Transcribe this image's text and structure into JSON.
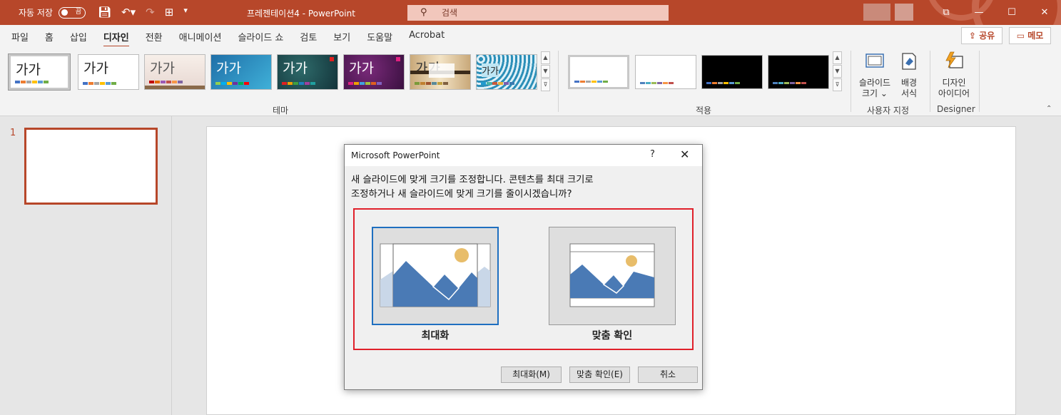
{
  "titlebar": {
    "autosave_label": "자동 저장",
    "autosave_state": "끔",
    "doc_title": "프레젠테이션4 - PowerPoint",
    "search_placeholder": "검색",
    "window_buttons": [
      "⧉",
      "—",
      "☐",
      "✕"
    ]
  },
  "menu": {
    "items": [
      "파일",
      "홈",
      "삽입",
      "디자인",
      "전환",
      "애니메이션",
      "슬라이드 쇼",
      "검토",
      "보기",
      "도움말",
      "Acrobat"
    ],
    "active": "디자인",
    "share": "공유",
    "memo": "메모"
  },
  "ribbon": {
    "theme_sample": "가가",
    "theme_group_label": "테마",
    "variant_group_label": "적용",
    "slide_size_line1": "슬라이드",
    "slide_size_line2": "크기",
    "bg_format_line1": "배경",
    "bg_format_line2": "서식",
    "customize_group_label": "사용자 지정",
    "designer_line1": "디자인",
    "designer_line2": "아이디어",
    "designer_group_label": "Designer"
  },
  "slides": {
    "number": "1"
  },
  "dialog": {
    "title": "Microsoft PowerPoint",
    "help": "?",
    "close": "✕",
    "message_line1": "새 슬라이드에 맞게 크기를 조정합니다. 콘텐츠를 최대 크기로",
    "message_line2": "조정하거나 새 슬라이드에 맞게 크기를 줄이시겠습니까?",
    "option_maximize": "최대화",
    "option_fit": "맞춤 확인",
    "btn_maximize": "최대화(M)",
    "btn_fit": "맞춤 확인(E)",
    "btn_cancel": "취소"
  },
  "colors": {
    "accent": "#b7472a",
    "dialog_highlight": "#e0202a",
    "selection_blue": "#1f6fc0",
    "mountain": "#4a7ab5",
    "sun": "#e8bd6a"
  }
}
